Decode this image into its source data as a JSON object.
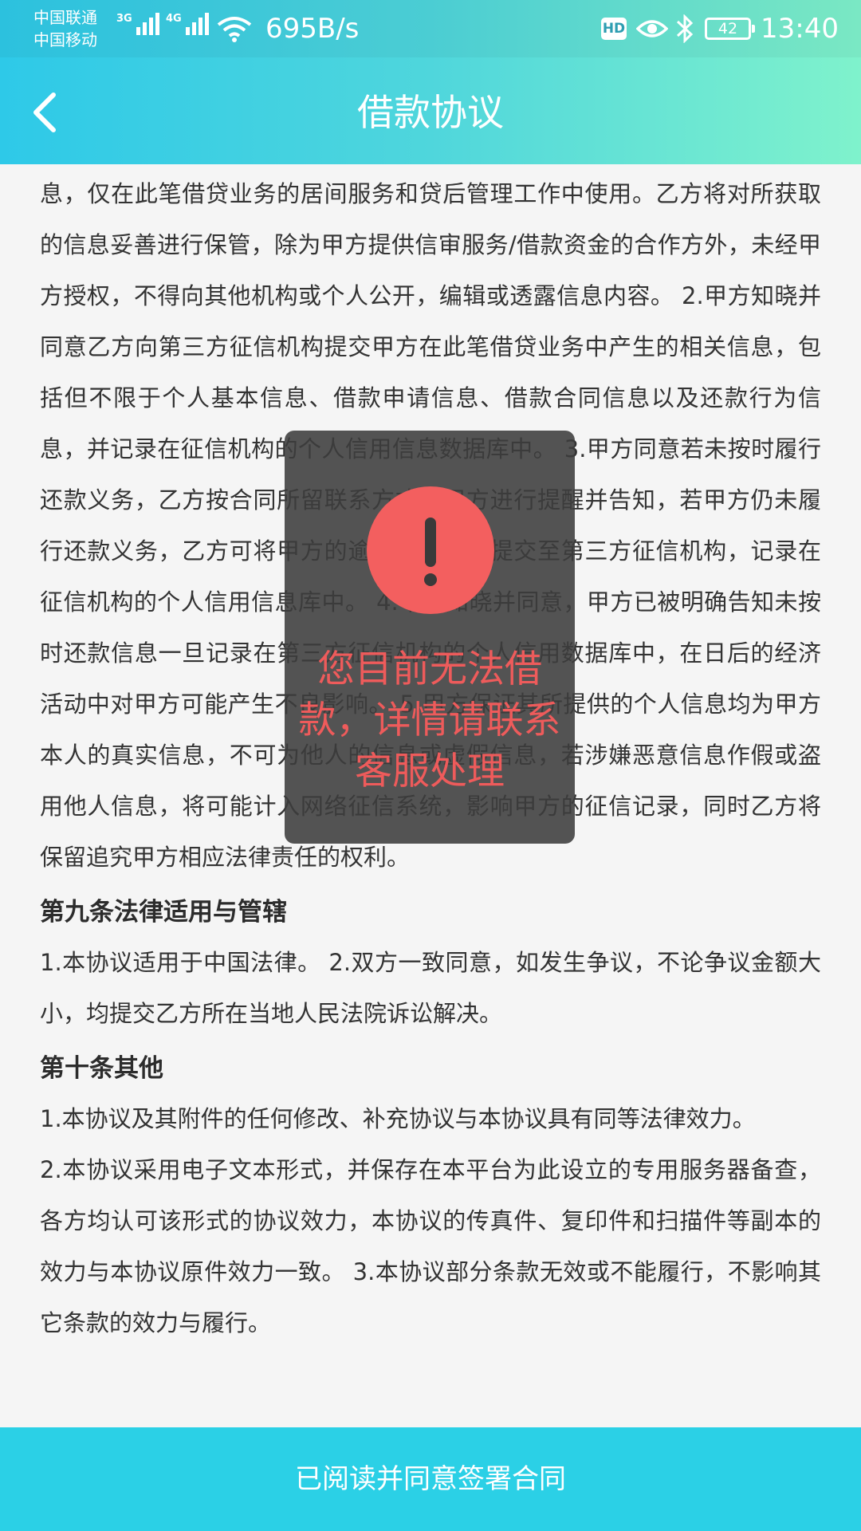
{
  "status_bar": {
    "carrier_1": "中国联通",
    "carrier_2": "中国移动",
    "network_1": "3G",
    "network_2": "4G",
    "speed": "695B/s",
    "hd": "HD",
    "battery": "42",
    "time": "13:40",
    "icons": [
      "signal-icon",
      "wifi-icon",
      "eye-icon",
      "bluetooth-icon",
      "battery-icon"
    ]
  },
  "header": {
    "title": "借款协议",
    "back_icon": "chevron-left-icon"
  },
  "agreement": {
    "para_intro": "息，仅在此笔借贷业务的居间服务和贷后管理工作中使用。乙方将对所获取的信息妥善进行保管，除为甲方提供信审服务/借款资金的合作方外，未经甲方授权，不得向其他机构或个人公开，编辑或透露信息内容。 2.甲方知晓并同意乙方向第三方征信机构提交甲方在此笔借贷业务中产生的相关信息，包括但不限于个人基本信息、借款申请信息、借款合同信息以及还款行为信息，并记录在征信机构的个人信用信息数据库中。 3.甲方同意若未按时履行还款义务，乙方按合同所留联系方式对甲方进行提醒并告知，若甲方仍未履行还款义务，乙方可将甲方的逾期还款信息提交至第三方征信机构，记录在征信机构的个人信用信息库中。 4.甲方知晓并同意，甲方已被明确告知未按时还款信息一旦记录在第三方征信机构的个人信用数据库中，在日后的经济活动中对甲方可能产生不良影响。 5.甲方保证其所提供的个人信息均为甲方本人的真实信息，不可为他人的信息或虚假信息，若涉嫌恶意信息作假或盗用他人信息，将可能计入网络征信系统，影响甲方的征信记录，同时乙方将保留追究甲方相应法律责任的权利。",
    "section_9_title": "第九条法律适用与管辖",
    "section_9_text": "1.本协议适用于中国法律。 2.双方一致同意，如发生争议，不论争议金额大小，均提交乙方所在当地人民法院诉讼解决。",
    "section_10_title": "第十条其他",
    "section_10_text_1": "1.本协议及其附件的任何修改、补充协议与本协议具有同等法律效力。",
    "section_10_text_2": "2.本协议采用电子文本形式，并保存在本平台为此设立的专用服务器备查，各方均认可该形式的协议效力，本协议的传真件、复印件和扫描件等副本的效力与本协议原件效力一致。 3.本协议部分条款无效或不能履行，不影响其它条款的效力与履行。"
  },
  "toast": {
    "icon": "exclamation-icon",
    "message": "您目前无法借款，详情请联系客服处理"
  },
  "footer": {
    "sign_button": "已阅读并同意签署合同"
  },
  "colors": {
    "header_gradient_start": "#2ec9e8",
    "header_gradient_end": "#7ff2cc",
    "button_bg": "#2bd0e6",
    "alert_red": "#f35f5f",
    "text": "#333333"
  }
}
